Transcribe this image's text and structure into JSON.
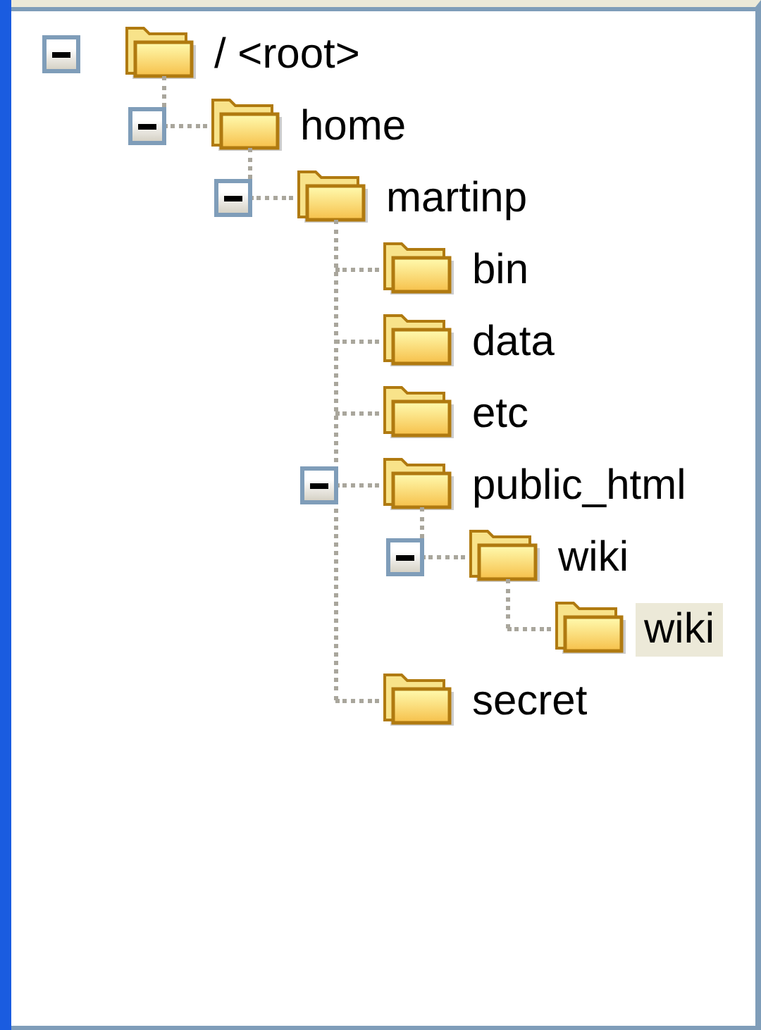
{
  "tree": [
    {
      "label": "/ <root>",
      "expanded": true,
      "selected": false,
      "children": [
        {
          "label": "home",
          "expanded": true,
          "selected": false,
          "children": [
            {
              "label": "martinp",
              "expanded": true,
              "selected": false,
              "children": [
                {
                  "label": "bin",
                  "selected": false
                },
                {
                  "label": "data",
                  "selected": false
                },
                {
                  "label": "etc",
                  "selected": false
                },
                {
                  "label": "public_html",
                  "expanded": true,
                  "selected": false,
                  "children": [
                    {
                      "label": "wiki",
                      "expanded": true,
                      "selected": false,
                      "children": [
                        {
                          "label": "wiki",
                          "selected": true
                        }
                      ]
                    }
                  ]
                },
                {
                  "label": "secret",
                  "selected": false
                }
              ]
            }
          ]
        }
      ]
    }
  ]
}
